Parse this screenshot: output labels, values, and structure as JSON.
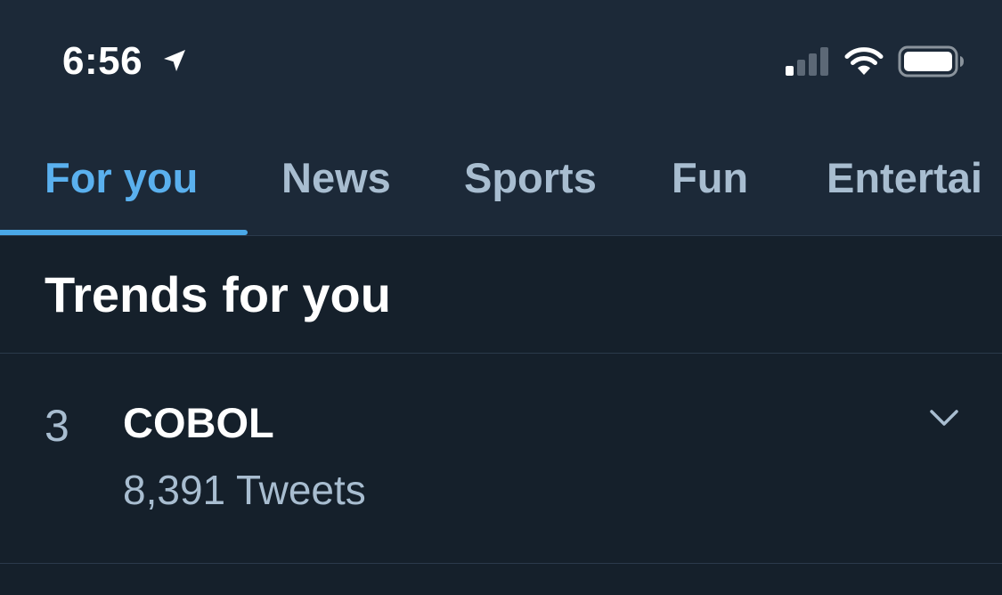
{
  "status_bar": {
    "time": "6:56",
    "icons": [
      "location-arrow-icon",
      "cellular-signal-icon",
      "wifi-icon",
      "battery-icon"
    ]
  },
  "tabs": [
    {
      "label": "For you",
      "active": true
    },
    {
      "label": "News",
      "active": false
    },
    {
      "label": "Sports",
      "active": false
    },
    {
      "label": "Fun",
      "active": false
    },
    {
      "label": "Entertai",
      "active": false
    }
  ],
  "section": {
    "title": "Trends for you"
  },
  "trends": [
    {
      "rank": "3",
      "name": "COBOL",
      "count": "8,391 Tweets",
      "menu_icon": "chevron-down-icon"
    }
  ],
  "colors": {
    "background": "#15202b",
    "header_background": "#1c2938",
    "accent": "#1da1f2",
    "secondary_text": "#a8bdd0"
  }
}
